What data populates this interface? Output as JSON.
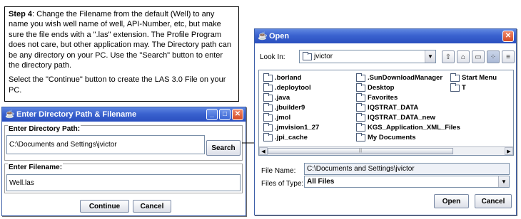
{
  "instructions": {
    "step_label": "Step 4",
    "paragraph1": ": Change the Filename from the default (Well) to any name you wish well name of well, API-Number, etc, but make sure the file ends with a \".las\" extension. The Profile Program does not care, but other application may.  The Directory path can be any directory on your PC.  Use the \"Search\" button to enter the directory path.",
    "paragraph2": "Select the \"Continue\" button to create the LAS 3.0 File on your PC."
  },
  "dir_dialog": {
    "title": "Enter Directory Path & Filename",
    "dir_group_label": "Enter Directory Path:",
    "dir_value": "C:\\Documents and Settings\\jvictor",
    "search_label": "Search",
    "file_group_label": "Enter Filename:",
    "file_value": "Well.las",
    "continue_label": "Continue",
    "cancel_label": "Cancel"
  },
  "open_dialog": {
    "title": "Open",
    "look_in_label": "Look In:",
    "look_in_value": "jvictor",
    "files": [
      ".borland",
      ".deploytool",
      ".java",
      ".jbuilder9",
      ".jmol",
      ".jmvision1_27",
      ".jpi_cache",
      ".SunDownloadManager",
      "Desktop",
      "Favorites",
      "IQSTRAT_DATA",
      "IQSTRAT_DATA_new",
      "KGS_Application_XML_Files",
      "My Documents",
      "Start Menu",
      "T"
    ],
    "file_name_label": "File Name:",
    "file_name_value": "C:\\Documents and Settings\\jvictor",
    "files_of_type_label": "Files of Type:",
    "files_of_type_value": "All Files",
    "open_label": "Open",
    "cancel_label": "Cancel"
  },
  "icons": {
    "java_cup": "java-cup-icon",
    "folder": "folder-icon",
    "close": "close-icon"
  },
  "colors": {
    "titlebar": "#3a62cf",
    "dialog_bg": "#ffffff",
    "close_button": "#d24a26"
  }
}
